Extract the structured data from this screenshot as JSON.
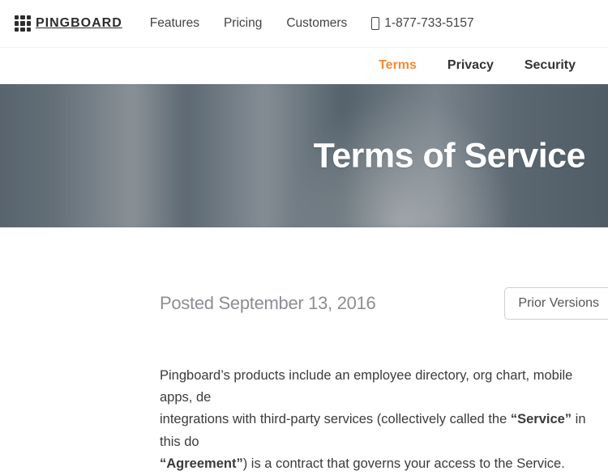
{
  "brand": {
    "name": "PINGBOARD"
  },
  "nav": {
    "items": [
      {
        "label": "Features"
      },
      {
        "label": "Pricing"
      },
      {
        "label": "Customers"
      }
    ],
    "phone": "1-877-733-5157"
  },
  "subnav": {
    "items": [
      {
        "label": "Terms",
        "active": true
      },
      {
        "label": "Privacy",
        "active": false
      },
      {
        "label": "Security",
        "active": false
      }
    ]
  },
  "hero": {
    "title": "Terms of Service"
  },
  "meta": {
    "posted_label": "Posted",
    "posted_date": "September 13, 2016",
    "prior_button": "Prior Versions"
  },
  "body": {
    "p1_a": "Pingboard’s products include an employee directory, org chart, mobile apps, de",
    "p1_b": "integrations with third-party services (collectively called the ",
    "p1_service": "“Service”",
    "p1_c": " in this do",
    "p1_agreement": "“Agreement”",
    "p1_d": ") is a contract that governs your access to the Service."
  }
}
